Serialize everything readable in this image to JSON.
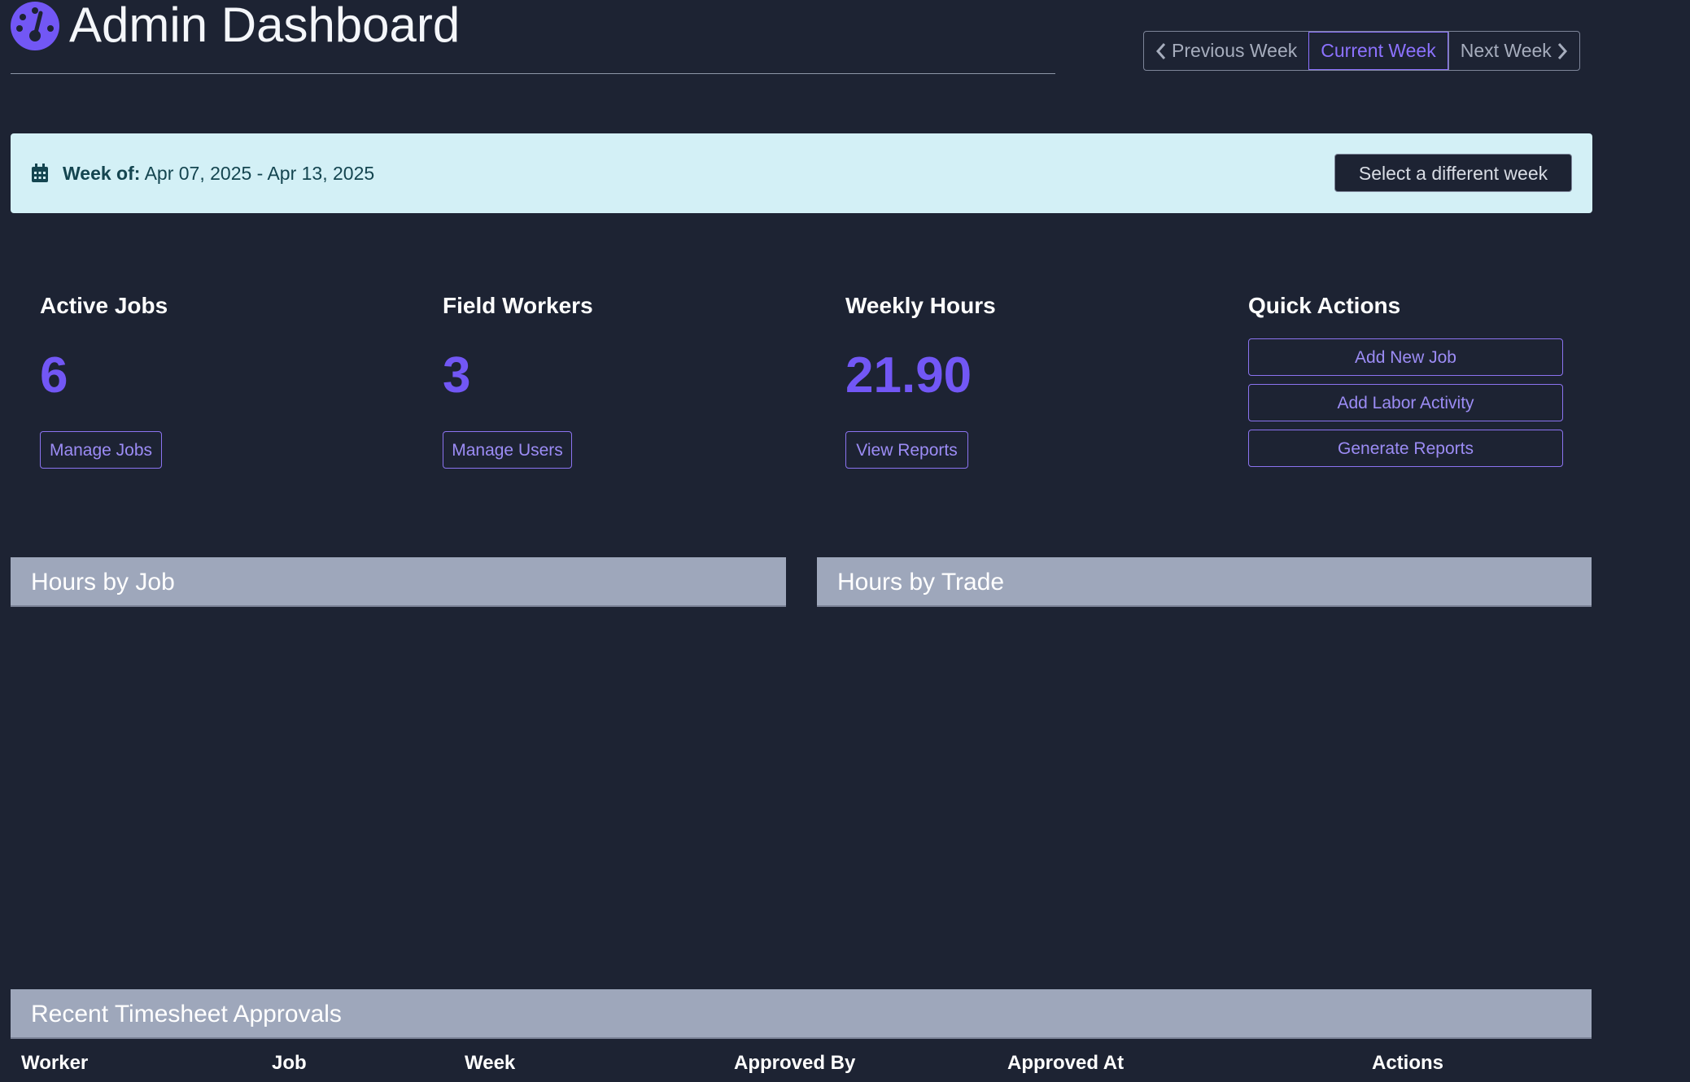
{
  "header": {
    "title": "Admin Dashboard",
    "icon": "tachometer-icon"
  },
  "week_nav": {
    "previous": "Previous Week",
    "current": "Current Week",
    "next": "Next Week"
  },
  "banner": {
    "label": "Week of:",
    "range": "Apr 07, 2025 - Apr 13, 2025",
    "select_button": "Select a different week"
  },
  "stats": [
    {
      "title": "Active Jobs",
      "value": "6",
      "button": "Manage Jobs"
    },
    {
      "title": "Field Workers",
      "value": "3",
      "button": "Manage Users"
    },
    {
      "title": "Weekly Hours",
      "value": "21.90",
      "button": "View Reports"
    }
  ],
  "quick_actions": {
    "title": "Quick Actions",
    "buttons": [
      "Add New Job",
      "Add Labor Activity",
      "Generate Reports"
    ]
  },
  "panels": {
    "hours_by_job": "Hours by Job",
    "hours_by_trade": "Hours by Trade"
  },
  "approvals": {
    "title": "Recent Timesheet Approvals",
    "columns": [
      "Worker",
      "Job",
      "Week",
      "Approved By",
      "Approved At",
      "Actions"
    ]
  },
  "colors": {
    "background": "#1d2333",
    "accent": "#7257f5",
    "banner": "#d3f0f6",
    "panel_header": "#9ea7bb"
  }
}
